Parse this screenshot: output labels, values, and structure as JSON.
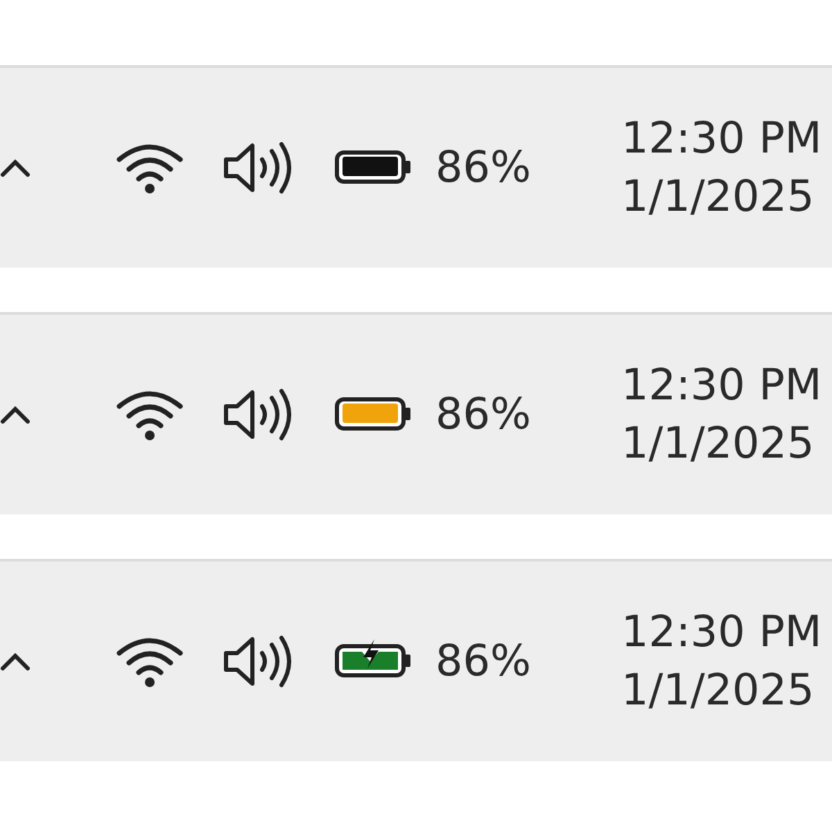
{
  "taskbars": [
    {
      "battery": {
        "kind": "normal",
        "color": "#111111",
        "percent": "86%"
      },
      "time": "12:30 PM",
      "date": "1/1/2025"
    },
    {
      "battery": {
        "kind": "saver",
        "color": "#f0a30a",
        "percent": "86%"
      },
      "time": "12:30 PM",
      "date": "1/1/2025"
    },
    {
      "battery": {
        "kind": "charging",
        "color": "#1a7f2a",
        "percent": "86%"
      },
      "time": "12:30 PM",
      "date": "1/1/2025"
    }
  ]
}
